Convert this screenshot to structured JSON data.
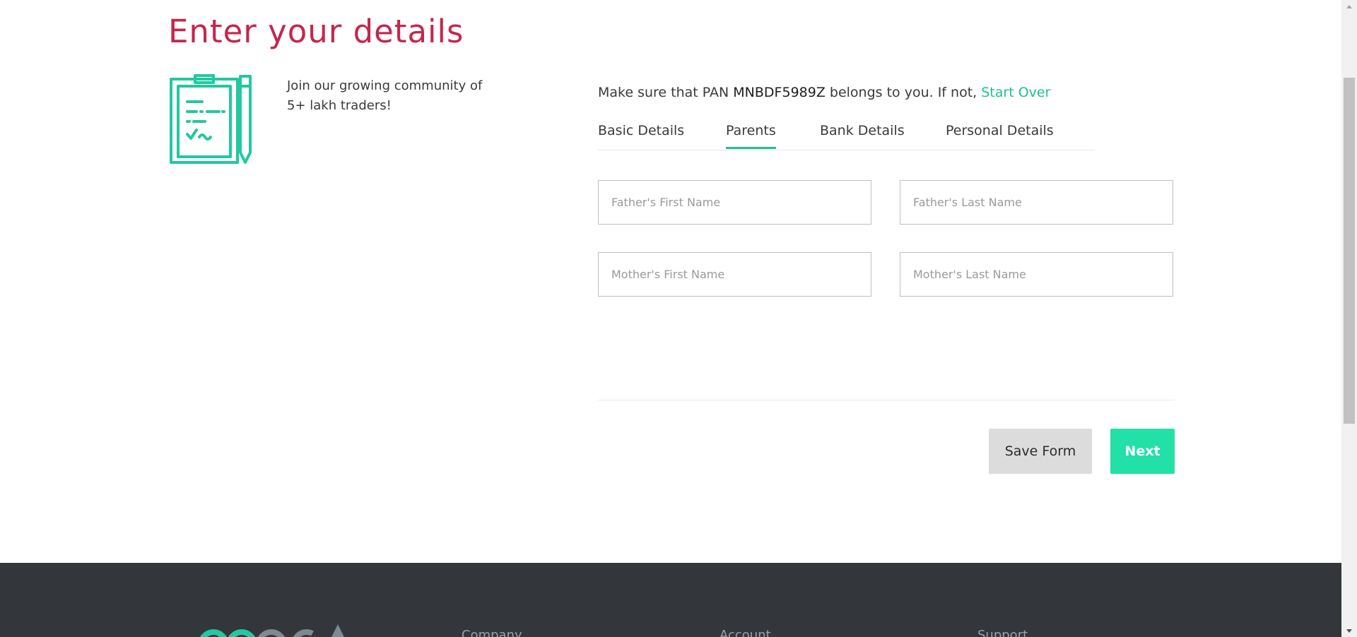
{
  "header": {
    "title": "Enter your details"
  },
  "intro": {
    "community_text": "Join our growing community of 5+ lakh traders!"
  },
  "pan_notice": {
    "prefix": "Make sure that PAN ",
    "pan": "MNBDF5989Z",
    "suffix": " belongs to you. If not, ",
    "start_over_label": "Start Over"
  },
  "tabs": [
    {
      "label": "Basic Details",
      "active": false
    },
    {
      "label": "Parents",
      "active": true
    },
    {
      "label": "Bank Details",
      "active": false
    },
    {
      "label": "Personal Details",
      "active": false
    }
  ],
  "form": {
    "fathers_first_name": {
      "placeholder": "Father's First Name",
      "value": ""
    },
    "fathers_last_name": {
      "placeholder": "Father's Last Name",
      "value": ""
    },
    "mothers_first_name": {
      "placeholder": "Mother's First Name",
      "value": ""
    },
    "mothers_last_name": {
      "placeholder": "Mother's Last Name",
      "value": ""
    }
  },
  "actions": {
    "save_label": "Save Form",
    "next_label": "Next"
  },
  "footer": {
    "headings": [
      "Company",
      "Account",
      "Support"
    ]
  },
  "colors": {
    "title": "#c5264d",
    "accent": "#22c08e",
    "next_button": "#22e0a6",
    "save_button": "#dcdcdc",
    "footer_bg": "#33373b"
  },
  "icons": {
    "intro": "clipboard-checklist-icon",
    "footer_logo": "brand-logo"
  }
}
